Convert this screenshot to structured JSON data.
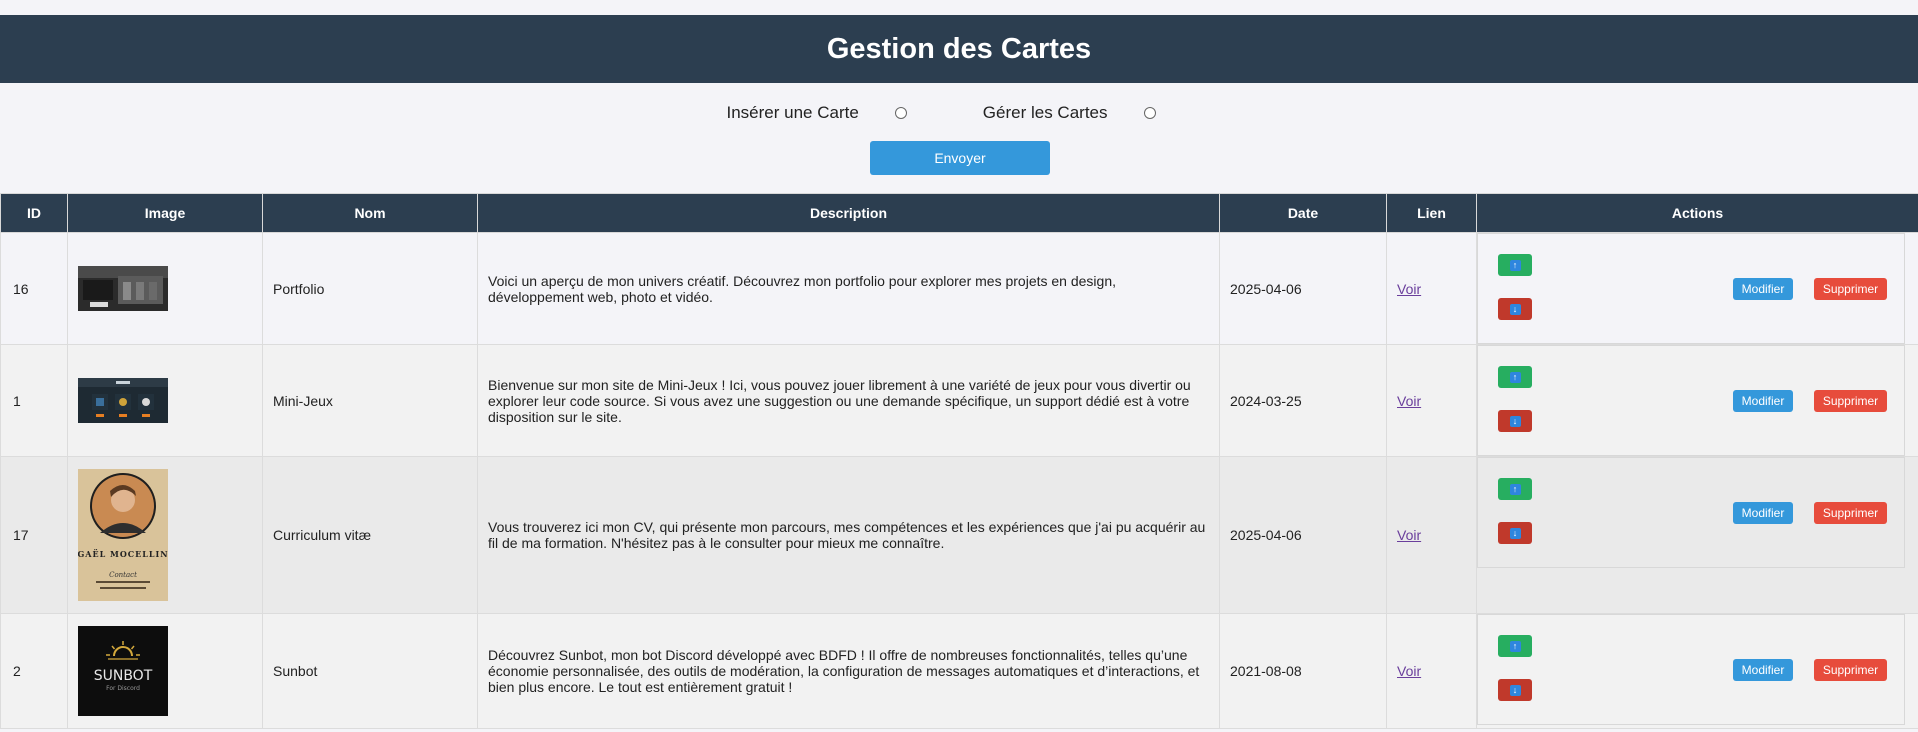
{
  "header": {
    "title": "Gestion des Cartes"
  },
  "form": {
    "option_insert": "Insérer une Carte",
    "option_manage": "Gérer les Cartes",
    "submit_label": "Envoyer"
  },
  "table": {
    "columns": [
      "ID",
      "Image",
      "Nom",
      "Description",
      "Date",
      "Lien",
      "Actions"
    ],
    "rows": [
      {
        "id": "16",
        "name": "Portfolio",
        "description": "Voici un aperçu de mon univers créatif. Découvrez mon portfolio pour explorer mes projets en design, développement web, photo et vidéo.",
        "date": "2025-04-06",
        "link": "Voir"
      },
      {
        "id": "1",
        "name": "Mini-Jeux",
        "description": "Bienvenue sur mon site de Mini-Jeux ! Ici, vous pouvez jouer librement à une variété de jeux pour vous divertir ou explorer leur code source. Si vous avez une suggestion ou une demande spécifique, un support dédié est à votre disposition sur le site.",
        "date": "2024-03-25",
        "link": "Voir"
      },
      {
        "id": "17",
        "name": "Curriculum vitæ",
        "description": "Vous trouverez ici mon CV, qui présente mon parcours, mes compétences et les expériences que j'ai pu acquérir au fil de ma formation. N'hésitez pas à le consulter pour mieux me connaître.",
        "date": "2025-04-06",
        "link": "Voir",
        "thumb_text": {
          "name": "GAËL MOCELLIN",
          "contact": "Contact"
        }
      },
      {
        "id": "2",
        "name": "Sunbot",
        "description": "Découvrez Sunbot, mon bot Discord développé avec BDFD ! Il offre de nombreuses fonctionnalités, telles qu’une économie personnalisée, des outils de modération, la configuration de messages automatiques et d’interactions, et bien plus encore. Le tout est entièrement gratuit !",
        "date": "2021-08-08",
        "link": "Voir",
        "thumb_text": {
          "name": "SUNBOT",
          "sub": "For Discord"
        }
      }
    ],
    "actions": {
      "edit_label": "Modifier",
      "delete_label": "Supprimer"
    }
  },
  "colors": {
    "header_bg": "#2c3e50",
    "primary_button": "#3498db",
    "move_up": "#27ae60",
    "move_down": "#c0392b",
    "delete": "#e74c3c",
    "link": "#6a3e9c"
  },
  "icons": {
    "move_up": "arrow-up-icon",
    "move_down": "arrow-down-icon"
  }
}
